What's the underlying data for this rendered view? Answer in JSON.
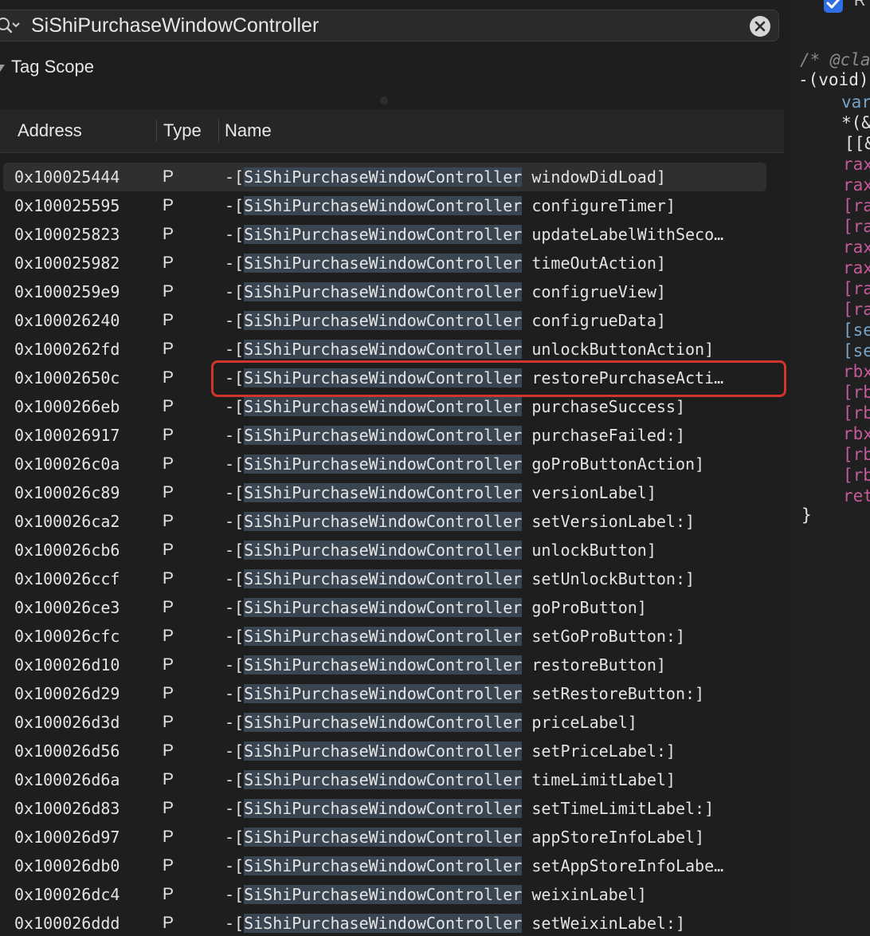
{
  "search": {
    "value": "SiShiPurchaseWindowController"
  },
  "scope": {
    "label": "Tag Scope"
  },
  "table": {
    "columns": [
      "Address",
      "Type",
      "Name"
    ],
    "rows": [
      {
        "address": "0x100025444",
        "type": "P",
        "prefix": "-[",
        "class": "SiShiPurchaseWindowController",
        "method": " windowDidLoad]"
      },
      {
        "address": "0x100025595",
        "type": "P",
        "prefix": "-[",
        "class": "SiShiPurchaseWindowController",
        "method": " configureTimer]"
      },
      {
        "address": "0x100025823",
        "type": "P",
        "prefix": "-[",
        "class": "SiShiPurchaseWindowController",
        "method": " updateLabelWithSeco…"
      },
      {
        "address": "0x100025982",
        "type": "P",
        "prefix": "-[",
        "class": "SiShiPurchaseWindowController",
        "method": " timeOutAction]"
      },
      {
        "address": "0x1000259e9",
        "type": "P",
        "prefix": "-[",
        "class": "SiShiPurchaseWindowController",
        "method": " configrueView]"
      },
      {
        "address": "0x100026240",
        "type": "P",
        "prefix": "-[",
        "class": "SiShiPurchaseWindowController",
        "method": " configrueData]"
      },
      {
        "address": "0x1000262fd",
        "type": "P",
        "prefix": "-[",
        "class": "SiShiPurchaseWindowController",
        "method": " unlockButtonAction]"
      },
      {
        "address": "0x10002650c",
        "type": "P",
        "prefix": "-[",
        "class": "SiShiPurchaseWindowController",
        "method": " restorePurchaseActi…"
      },
      {
        "address": "0x1000266eb",
        "type": "P",
        "prefix": "-[",
        "class": "SiShiPurchaseWindowController",
        "method": " purchaseSuccess]"
      },
      {
        "address": "0x100026917",
        "type": "P",
        "prefix": "-[",
        "class": "SiShiPurchaseWindowController",
        "method": " purchaseFailed:]"
      },
      {
        "address": "0x100026c0a",
        "type": "P",
        "prefix": "-[",
        "class": "SiShiPurchaseWindowController",
        "method": " goProButtonAction]"
      },
      {
        "address": "0x100026c89",
        "type": "P",
        "prefix": "-[",
        "class": "SiShiPurchaseWindowController",
        "method": " versionLabel]"
      },
      {
        "address": "0x100026ca2",
        "type": "P",
        "prefix": "-[",
        "class": "SiShiPurchaseWindowController",
        "method": " setVersionLabel:]"
      },
      {
        "address": "0x100026cb6",
        "type": "P",
        "prefix": "-[",
        "class": "SiShiPurchaseWindowController",
        "method": " unlockButton]"
      },
      {
        "address": "0x100026ccf",
        "type": "P",
        "prefix": "-[",
        "class": "SiShiPurchaseWindowController",
        "method": " setUnlockButton:]"
      },
      {
        "address": "0x100026ce3",
        "type": "P",
        "prefix": "-[",
        "class": "SiShiPurchaseWindowController",
        "method": " goProButton]"
      },
      {
        "address": "0x100026cfc",
        "type": "P",
        "prefix": "-[",
        "class": "SiShiPurchaseWindowController",
        "method": " setGoProButton:]"
      },
      {
        "address": "0x100026d10",
        "type": "P",
        "prefix": "-[",
        "class": "SiShiPurchaseWindowController",
        "method": " restoreButton]"
      },
      {
        "address": "0x100026d29",
        "type": "P",
        "prefix": "-[",
        "class": "SiShiPurchaseWindowController",
        "method": " setRestoreButton:]"
      },
      {
        "address": "0x100026d3d",
        "type": "P",
        "prefix": "-[",
        "class": "SiShiPurchaseWindowController",
        "method": " priceLabel]"
      },
      {
        "address": "0x100026d56",
        "type": "P",
        "prefix": "-[",
        "class": "SiShiPurchaseWindowController",
        "method": " setPriceLabel:]"
      },
      {
        "address": "0x100026d6a",
        "type": "P",
        "prefix": "-[",
        "class": "SiShiPurchaseWindowController",
        "method": " timeLimitLabel]"
      },
      {
        "address": "0x100026d83",
        "type": "P",
        "prefix": "-[",
        "class": "SiShiPurchaseWindowController",
        "method": " setTimeLimitLabel:]"
      },
      {
        "address": "0x100026d97",
        "type": "P",
        "prefix": "-[",
        "class": "SiShiPurchaseWindowController",
        "method": " appStoreInfoLabel]"
      },
      {
        "address": "0x100026db0",
        "type": "P",
        "prefix": "-[",
        "class": "SiShiPurchaseWindowController",
        "method": " setAppStoreInfoLabe…"
      },
      {
        "address": "0x100026dc4",
        "type": "P",
        "prefix": "-[",
        "class": "SiShiPurchaseWindowController",
        "method": " weixinLabel]"
      },
      {
        "address": "0x100026ddd",
        "type": "P",
        "prefix": "-[",
        "class": "SiShiPurchaseWindowController",
        "method": " setWeixinLabel:]"
      }
    ]
  },
  "right_pane": {
    "checkbox_label": "R",
    "code_lines": [
      {
        "text": "/* @cla",
        "color": "#8a8a8a",
        "italic": true
      },
      {
        "text": "-(void)",
        "color": "#e4e4e4"
      },
      {
        "text": "var",
        "color": "#77a4c7"
      },
      {
        "text": "*(&",
        "color": "#e4e4e4"
      },
      {
        "text": "[[&",
        "color": "#e4e4e4"
      },
      {
        "text": "rax",
        "color": "#c45a9a"
      },
      {
        "text": "rax",
        "color": "#c45a9a"
      },
      {
        "text": "[ra",
        "color": "#c45a9a"
      },
      {
        "text": "[ra",
        "color": "#c45a9a"
      },
      {
        "text": "rax",
        "color": "#c45a9a"
      },
      {
        "text": "rax",
        "color": "#c45a9a"
      },
      {
        "text": "[ra",
        "color": "#c45a9a"
      },
      {
        "text": "[ra",
        "color": "#c45a9a"
      },
      {
        "text": "[se",
        "color": "#77a4c7"
      },
      {
        "text": "[se",
        "color": "#77a4c7"
      },
      {
        "text": "rbx",
        "color": "#c45a9a"
      },
      {
        "text": "[rb",
        "color": "#c45a9a"
      },
      {
        "text": "[rb",
        "color": "#c45a9a"
      },
      {
        "text": "rbx",
        "color": "#c45a9a"
      },
      {
        "text": "[rb",
        "color": "#c45a9a"
      },
      {
        "text": "[rb",
        "color": "#c45a9a"
      },
      {
        "text": "ret",
        "color": "#c45a9a"
      },
      {
        "text": "}",
        "color": "#e4e4e4"
      }
    ]
  }
}
